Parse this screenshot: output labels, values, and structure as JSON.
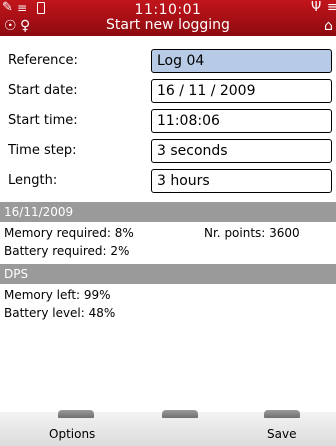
{
  "status_bar": {
    "time": "11:10:01",
    "title": "Start new logging",
    "icons": [
      "pen-icon",
      "menu-icon",
      "battery-icon",
      "antenna-icon",
      "menu-icon",
      "sensor-icon",
      "person-icon",
      "device-icon"
    ]
  },
  "form": {
    "reference_label": "Reference:",
    "reference_value": "Log 04",
    "start_date_label": "Start date:",
    "start_date_value": "16 / 11 / 2009",
    "start_time_label": "Start time:",
    "start_time_value": "11:08:06",
    "time_step_label": "Time step:",
    "time_step_value": "3 seconds",
    "length_label": "Length:",
    "length_value": "3 hours"
  },
  "summary": {
    "date_header": "16/11/2009",
    "memory_required": "Memory required: 8%",
    "nr_points": "Nr. points: 3600",
    "battery_required": "Battery required: 2%"
  },
  "device": {
    "header": "DPS",
    "memory_left": "Memory left: 99%",
    "battery_level": "Battery level: 48%"
  },
  "softkeys": {
    "left": "Options",
    "right": "Save"
  },
  "colors": {
    "header_red": "#b01218",
    "active_field": "#b7cbe6",
    "band_gray": "#9a9a9a"
  }
}
